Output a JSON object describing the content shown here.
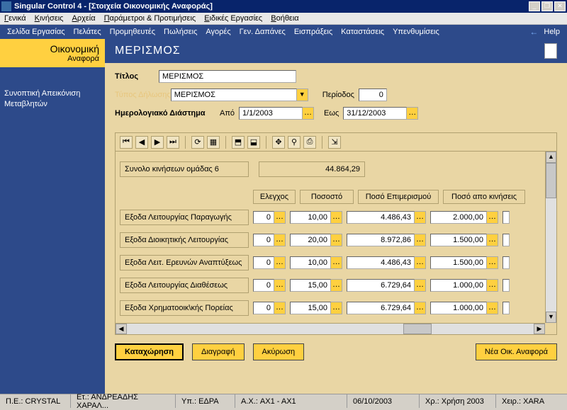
{
  "window": {
    "title": "Singular Control 4 - [Στοιχεία Οικονομικής Αναφοράς]"
  },
  "menubar1": {
    "items": [
      "Γενικά",
      "Κινήσεις",
      "Αρχεία",
      "Παράμετροι & Προτιμήσεις",
      "Ειδικές Εργασίες",
      "Βοήθεια"
    ]
  },
  "menubar2": {
    "items": [
      "Σελίδα Εργασίας",
      "Πελάτες",
      "Προμηθευτές",
      "Πωλήσεις",
      "Αγορές",
      "Γεν. Δαπάνες",
      "Εισπράξεις",
      "Καταστάσεις",
      "Υπενθυμίσεις"
    ],
    "help": "Help"
  },
  "sidebar": {
    "header1": "Οικονομική",
    "header2": "Αναφορά",
    "link1": "Συνοπτική Απεικόνιση",
    "link2": "Μεταβλητών"
  },
  "content": {
    "heading": "ΜΕΡΙΣΜΟΣ",
    "labels": {
      "title": "Τίτλος",
      "decl_type": "Τύπος Δήλωσης",
      "period": "Περίοδος",
      "date_range": "Ημερολογιακό Διάστημα",
      "from": "Από",
      "to": "Εως",
      "group_total": "Συνολο κινήσεων ομάδας 6"
    },
    "values": {
      "title": "ΜΕΡΙΣΜΟΣ",
      "decl_type": "ΜΕΡΙΣΜΟΣ",
      "period": "0",
      "from": "1/1/2003",
      "to": "31/12/2003",
      "group_total": "44.864,29"
    },
    "grid": {
      "headers": [
        "Ελεγχος",
        "Ποσοστό",
        "Ποσό Επιμερισμού",
        "Ποσό απο κινήσεις"
      ],
      "rows": [
        {
          "label": "Εξοδα Λειτουργίας Παραγωγής",
          "check": "0",
          "pct": "10,00",
          "alloc": "4.486,43",
          "mov": "2.000,00"
        },
        {
          "label": "Εξοδα Διοικητικής Λειτουργίας",
          "check": "0",
          "pct": "20,00",
          "alloc": "8.972,86",
          "mov": "1.500,00"
        },
        {
          "label": "Εξοδα Λειτ. Ερευνών Αναπτύξεως",
          "check": "0",
          "pct": "10,00",
          "alloc": "4.486,43",
          "mov": "1.500,00"
        },
        {
          "label": "Εξοδα Λειτουργίας Διαθέσεως",
          "check": "0",
          "pct": "15,00",
          "alloc": "6.729,64",
          "mov": "1.000,00"
        },
        {
          "label": "Εξοδα Χρηματοοικ\\κής Πορείας",
          "check": "0",
          "pct": "15,00",
          "alloc": "6.729,64",
          "mov": "1.000,00"
        }
      ]
    },
    "buttons": {
      "save": "Καταχώρηση",
      "delete": "Διαγραφή",
      "cancel": "Ακύρωση",
      "new_report": "Νέα Οικ. Αναφορά"
    }
  },
  "statusbar": {
    "pe": "Π.Ε.: CRYSTAL",
    "et": "Ετ.: ΑΝΔΡΕΑΔΗΣ ΧΑΡΑΛ...",
    "yp": "Υπ.: ΕΔΡΑ",
    "ax": "Α.Χ.: AX1 - AX1",
    "date": "06/10/2003",
    "xr": "Χρ.: Χρήση 2003",
    "xeir": "Χειρ.: XARA"
  }
}
